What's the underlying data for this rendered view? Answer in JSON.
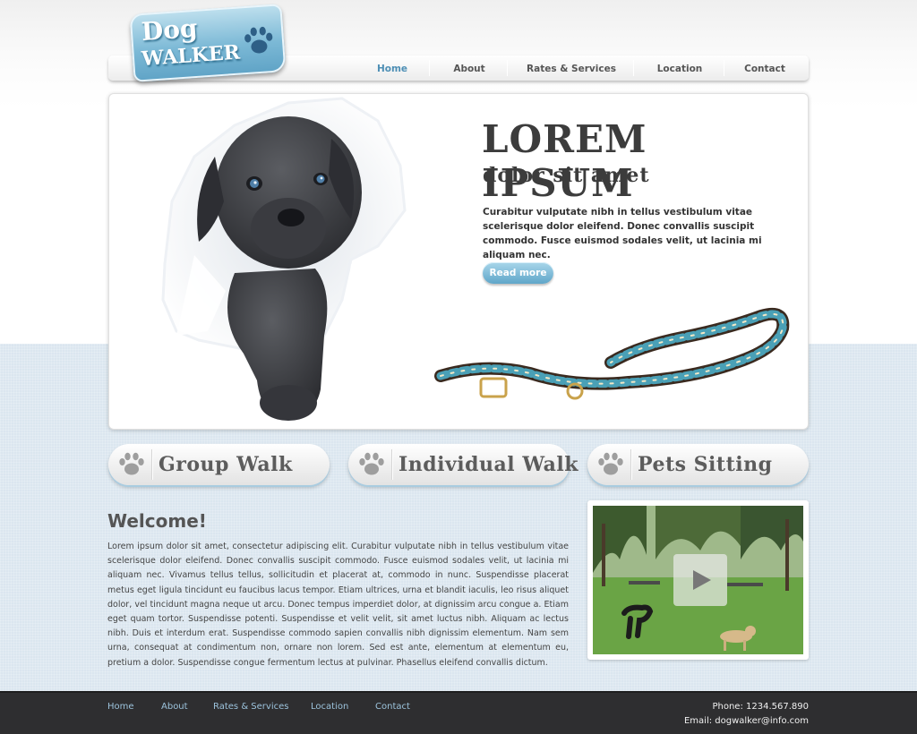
{
  "brand": {
    "word1": "Dog",
    "word2": "WALKER"
  },
  "nav": {
    "items": [
      "Home",
      "About",
      "Rates & Services",
      "Location",
      "Contact"
    ],
    "active": "Home"
  },
  "hero": {
    "title": "LOREM IPSUM",
    "subtitle": "dolor sit amet",
    "text": "Curabitur vulputate nibh in tellus vestibulum vitae scelerisque dolor eleifend. Donec convallis suscipit commodo. Fusce euismod sodales velit, ut lacinia mi aliquam nec.",
    "button": "Read more"
  },
  "services": [
    "Group Walk",
    "Individual Walk",
    "Pets Sitting"
  ],
  "welcome": {
    "title": "Welcome!",
    "text": "Lorem ipsum dolor sit amet, consectetur adipiscing elit. Curabitur vulputate nibh in tellus vestibulum vitae scelerisque dolor eleifend. Donec convallis suscipit commodo. Fusce euismod sodales velit, ut lacinia mi aliquam nec. Vivamus tellus tellus, sollicitudin et placerat at, commodo in nunc. Suspendisse placerat metus eget ligula tincidunt eu faucibus lacus tempor. Etiam ultrices, urna et blandit iaculis, leo risus aliquet dolor, vel tincidunt magna neque ut arcu. Donec tempus imperdiet dolor, at dignissim arcu congue a. Etiam eget quam tortor. Suspendisse potenti. Suspendisse et velit velit, sit amet luctus nibh. Aliquam ac lectus nibh. Duis et interdum erat. Suspendisse commodo sapien convallis nibh dignissim elementum. Nam sem urna, consequat at condimentum non, ornare non lorem. Sed est ante, elementum at elementum eu, pretium a dolor. Suspendisse congue fermentum lectus at pulvinar. Phasellus eleifend convallis dictum."
  },
  "video": {
    "icon": "play-icon"
  },
  "footer": {
    "links": [
      "Home",
      "About",
      "Rates & Services",
      "Location",
      "Contact"
    ],
    "phone": "Phone: 1234.567.890",
    "email": "Email: dogwalker@info.com"
  },
  "colors": {
    "accent": "#4e8fb5",
    "page_band": "#dbe6ef",
    "footer_bg": "#2e2e30",
    "footer_link": "#9cc3dc",
    "logo_blue": "#7cb9d6"
  }
}
